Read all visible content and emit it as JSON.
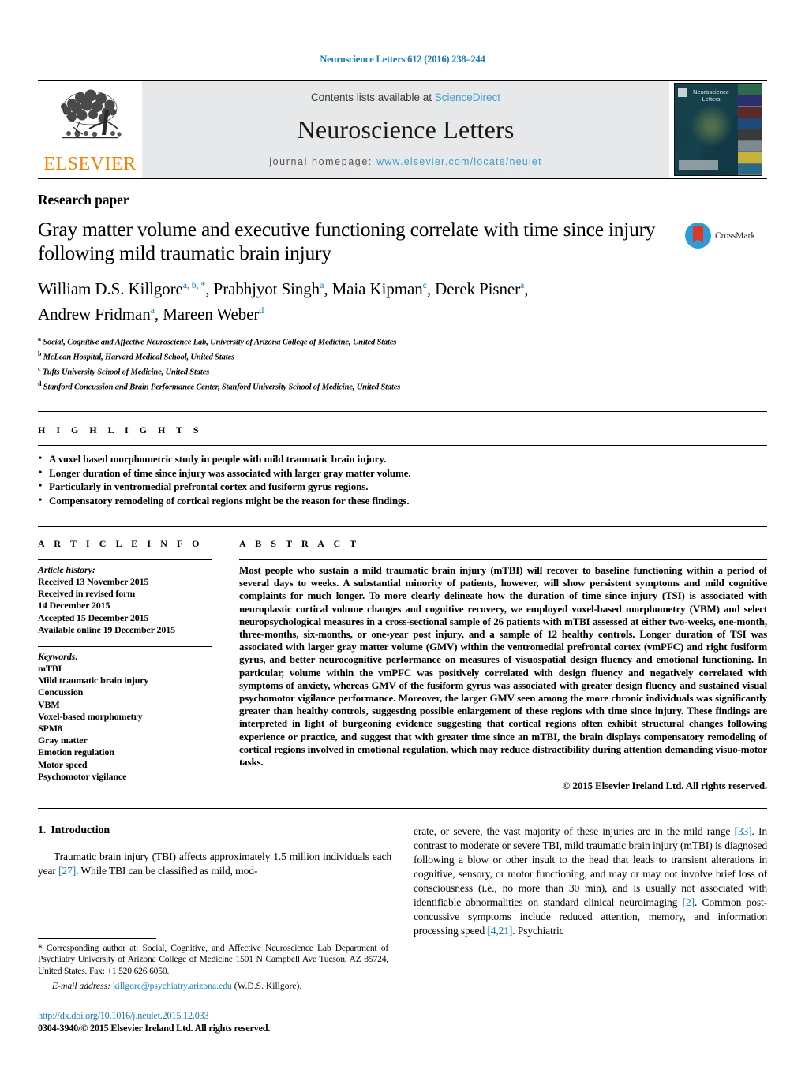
{
  "running_head": "Neuroscience Letters 612 (2016) 238–244",
  "masthead": {
    "publisher_name": "ELSEVIER",
    "contents_prefix": "Contents lists available at ",
    "contents_link": "ScienceDirect",
    "journal_title": "Neuroscience Letters",
    "homepage_prefix": "journal homepage: ",
    "homepage_url": "www.elsevier.com/locate/neulet",
    "cover_title": "Neuroscience Letters"
  },
  "article": {
    "type": "Research paper",
    "title": "Gray matter volume and executive functioning correlate with time since injury following mild traumatic brain injury",
    "crossmark_label": "CrossMark",
    "authors_line1": "William D.S. Killgore",
    "authors": [
      {
        "name": "William D.S. Killgore",
        "sup": "a, b, *"
      },
      {
        "name": "Prabhjyot Singh",
        "sup": "a"
      },
      {
        "name": "Maia Kipman",
        "sup": "c"
      },
      {
        "name": "Derek Pisner",
        "sup": "a"
      },
      {
        "name": "Andrew Fridman",
        "sup": "a"
      },
      {
        "name": "Mareen Weber",
        "sup": "d"
      }
    ],
    "affiliations": [
      {
        "label": "a",
        "text": "Social, Cognitive and Affective Neuroscience Lab, University of Arizona College of Medicine, United States"
      },
      {
        "label": "b",
        "text": "McLean Hospital, Harvard Medical School, United States"
      },
      {
        "label": "c",
        "text": "Tufts University School of Medicine, United States"
      },
      {
        "label": "d",
        "text": "Stanford Concussion and Brain Performance Center, Stanford University School of Medicine, United States"
      }
    ]
  },
  "highlights": {
    "heading": "H I G H L I G H T S",
    "items": [
      "A voxel based morphometric study in people with mild traumatic brain injury.",
      "Longer duration of time since injury was associated with larger gray matter volume.",
      "Particularly in ventromedial prefrontal cortex and fusiform gyrus regions.",
      "Compensatory remodeling of cortical regions might be the reason for these findings."
    ]
  },
  "article_info": {
    "heading": "A R T I C L E   I N F O",
    "history_label": "Article history:",
    "history": [
      "Received 13 November 2015",
      "Received in revised form",
      "14 December 2015",
      "Accepted 15 December 2015",
      "Available online 19 December 2015"
    ],
    "keywords_label": "Keywords:",
    "keywords": [
      "mTBI",
      "Mild traumatic brain injury",
      "Concussion",
      "VBM",
      "Voxel-based morphometry",
      "SPM8",
      "Gray matter",
      "Emotion regulation",
      "Motor speed",
      "Psychomotor vigilance"
    ]
  },
  "abstract": {
    "heading": "A B S T R A C T",
    "text": "Most people who sustain a mild traumatic brain injury (mTBI) will recover to baseline functioning within a period of several days to weeks. A substantial minority of patients, however, will show persistent symptoms and mild cognitive complaints for much longer. To more clearly delineate how the duration of time since injury (TSI) is associated with neuroplastic cortical volume changes and cognitive recovery, we employed voxel-based morphometry (VBM) and select neuropsychological measures in a cross-sectional sample of 26 patients with mTBI assessed at either two-weeks, one-month, three-months, six-months, or one-year post injury, and a sample of 12 healthy controls. Longer duration of TSI was associated with larger gray matter volume (GMV) within the ventromedial prefrontal cortex (vmPFC) and right fusiform gyrus, and better neurocognitive performance on measures of visuospatial design fluency and emotional functioning. In particular, volume within the vmPFC was positively correlated with design fluency and negatively correlated with symptoms of anxiety, whereas GMV of the fusiform gyrus was associated with greater design fluency and sustained visual psychomotor vigilance performance. Moreover, the larger GMV seen among the more chronic individuals was significantly greater than healthy controls, suggesting possible enlargement of these regions with time since injury. These findings are interpreted in light of burgeoning evidence suggesting that cortical regions often exhibit structural changes following experience or practice, and suggest that with greater time since an mTBI, the brain displays compensatory remodeling of cortical regions involved in emotional regulation, which may reduce distractibility during attention demanding visuo-motor tasks.",
    "copyright": "© 2015 Elsevier Ireland Ltd. All rights reserved."
  },
  "introduction": {
    "number": "1.",
    "title": "Introduction",
    "left_para_a": "Traumatic brain injury (TBI) affects approximately 1.5 million individuals each year ",
    "left_ref_1": "[27]",
    "left_para_b": ". While TBI can be classified as mild, mod-",
    "right_para_a": "erate, or severe, the vast majority of these injuries are in the mild range ",
    "right_ref_1": "[33]",
    "right_para_b": ". In contrast to moderate or severe TBI, mild traumatic brain injury (mTBI) is diagnosed following a blow or other insult to the head that leads to transient alterations in cognitive, sensory, or motor functioning, and may or may not involve brief loss of consciousness (i.e., no more than 30 min), and is usually not associated with identifiable abnormalities on standard clinical neuroimaging ",
    "right_ref_2": "[2]",
    "right_para_c": ". Common post-concussive symptoms include reduced attention, memory, and information processing speed ",
    "right_ref_3": "[4,21]",
    "right_para_d": ". Psychiatric"
  },
  "footnotes": {
    "corresponding": "* Corresponding author at: Social, Cognitive, and Affective Neuroscience Lab Department of Psychiatry University of Arizona College of Medicine 1501 N Campbell Ave Tucson, AZ 85724, United States. Fax: +1 520 626 6050.",
    "email_label": "E-mail address:",
    "email": "killgore@psychiatry.arizona.edu",
    "email_suffix": "(W.D.S. Killgore)."
  },
  "footer": {
    "doi": "http://dx.doi.org/10.1016/j.neulet.2015.12.033",
    "issn": "0304-3940/© 2015 Elsevier Ireland Ltd. All rights reserved."
  },
  "colors": {
    "link": "#1a7bb9",
    "sciencedirect": "#3f9fd0",
    "elsevier_orange": "#f08000"
  }
}
